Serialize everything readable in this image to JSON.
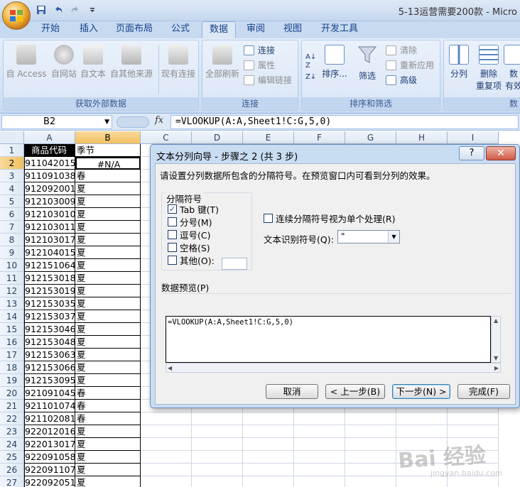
{
  "title": "5-13运营需要200款 - Micro",
  "qat": [
    "save-icon",
    "undo-icon",
    "redo-icon",
    "customize-icon"
  ],
  "tabs": [
    "开始",
    "插入",
    "页面布局",
    "公式",
    "数据",
    "审阅",
    "视图",
    "开发工具"
  ],
  "active_tab": "数据",
  "ribbon": {
    "get_external_data": {
      "label": "获取外部数据",
      "buttons": [
        "自 Access",
        "自网站",
        "自文本",
        "自其他来源",
        "现有连接"
      ]
    },
    "connections": {
      "label": "连接",
      "refresh_all": "全部刷新",
      "small": [
        "连接",
        "属性",
        "编辑链接"
      ]
    },
    "sort_filter": {
      "label": "排序和筛选",
      "sort": "排序...",
      "filter": "筛选",
      "small": [
        "清除",
        "重新应用",
        "高级"
      ]
    },
    "data_tools": {
      "label": "数",
      "split": "分列",
      "remove_dup_1": "删除",
      "remove_dup_2": "重复项",
      "validity_1": "数",
      "validity_2": "有效"
    }
  },
  "formula_bar": {
    "name_box": "B2",
    "fx": "fx",
    "formula": "=VLOOKUP(A:A,Sheet1!C:G,5,0)"
  },
  "columns": [
    "A",
    "B",
    "C",
    "D",
    "E",
    "F",
    "G",
    "H",
    "I"
  ],
  "selected_column": "B",
  "rows": [
    {
      "n": "1",
      "a": "商品代码",
      "b": "季节"
    },
    {
      "n": "2",
      "a": "911042015",
      "b": "#N/A"
    },
    {
      "n": "3",
      "a": "911091038",
      "b": "春"
    },
    {
      "n": "4",
      "a": "912092001",
      "b": "夏"
    },
    {
      "n": "5",
      "a": "912103009",
      "b": "夏"
    },
    {
      "n": "6",
      "a": "912103010",
      "b": "夏"
    },
    {
      "n": "7",
      "a": "912103011",
      "b": "夏"
    },
    {
      "n": "8",
      "a": "912103017",
      "b": "夏"
    },
    {
      "n": "9",
      "a": "912104015",
      "b": "夏"
    },
    {
      "n": "10",
      "a": "912151064",
      "b": "夏"
    },
    {
      "n": "11",
      "a": "912153018",
      "b": "夏"
    },
    {
      "n": "12",
      "a": "912153019",
      "b": "夏"
    },
    {
      "n": "13",
      "a": "912153035",
      "b": "夏"
    },
    {
      "n": "14",
      "a": "912153037",
      "b": "夏"
    },
    {
      "n": "15",
      "a": "912153046",
      "b": "夏"
    },
    {
      "n": "16",
      "a": "912153048",
      "b": "夏"
    },
    {
      "n": "17",
      "a": "912153063",
      "b": "夏"
    },
    {
      "n": "18",
      "a": "912153066",
      "b": "夏"
    },
    {
      "n": "19",
      "a": "912153095",
      "b": "夏"
    },
    {
      "n": "20",
      "a": "921091045",
      "b": "春"
    },
    {
      "n": "21",
      "a": "921101074",
      "b": "春"
    },
    {
      "n": "22",
      "a": "921102081",
      "b": "春"
    },
    {
      "n": "23",
      "a": "922012016",
      "b": "夏"
    },
    {
      "n": "24",
      "a": "922013017",
      "b": "夏"
    },
    {
      "n": "25",
      "a": "922091058",
      "b": "夏"
    },
    {
      "n": "26",
      "a": "922091107",
      "b": "夏"
    },
    {
      "n": "27",
      "a": "922092051",
      "b": "夏"
    }
  ],
  "dialog": {
    "title": "文本分列向导 - 步骤之 2 (共 3 步)",
    "help": "?",
    "close": "✕",
    "description": "请设置分列数据所包含的分隔符号。在预览窗口内可看到分列的效果。",
    "delimiters_legend": "分隔符号",
    "delimiters": [
      {
        "label": "Tab 键(T)",
        "checked": true
      },
      {
        "label": "分号(M)",
        "checked": false
      },
      {
        "label": "逗号(C)",
        "checked": false
      },
      {
        "label": "空格(S)",
        "checked": false
      },
      {
        "label": "其他(O):",
        "checked": false
      }
    ],
    "consecutive": "连续分隔符号视为单个处理(R)",
    "qualifier_label": "文本识别符号(Q):",
    "qualifier_value": "\"",
    "preview_label": "数据预览(P)",
    "preview_text": "=VLOOKUP(A:A,Sheet1!C:G,5,0)",
    "buttons": {
      "cancel": "取消",
      "back": "< 上一步(B)",
      "next": "下一步(N) >",
      "finish": "完成(F)"
    }
  },
  "watermark": {
    "main": "Bai 经验",
    "sub": "jingyan.baidu.com"
  }
}
